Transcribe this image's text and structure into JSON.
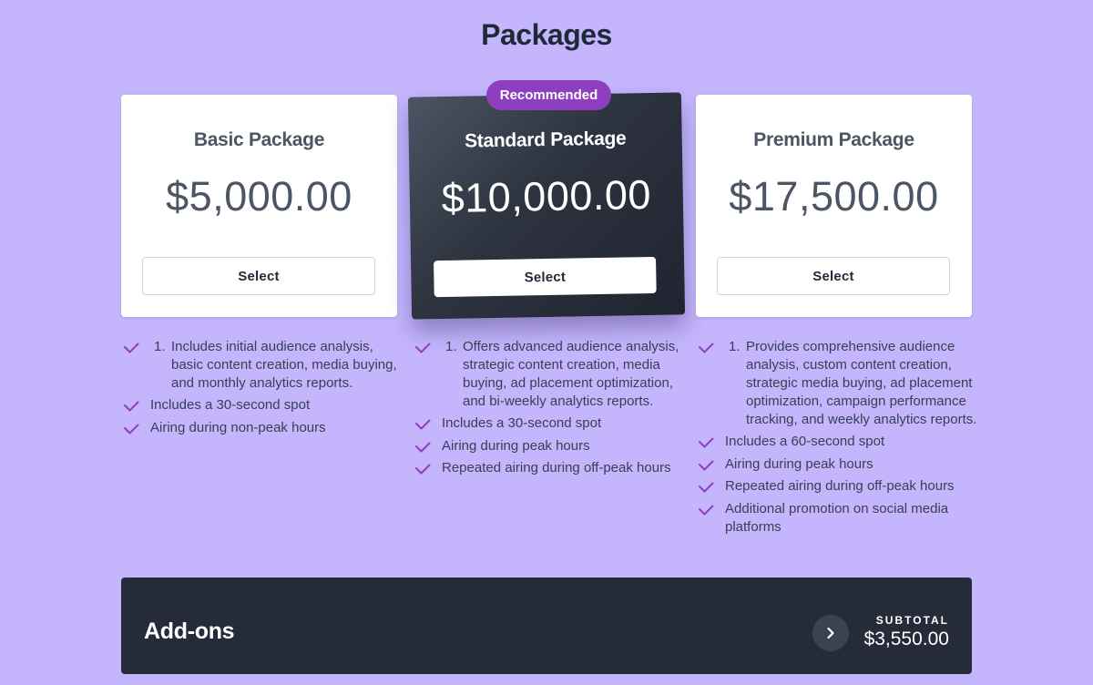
{
  "page": {
    "title": "Packages"
  },
  "badge": "Recommended",
  "packages": [
    {
      "name": "Basic Package",
      "price": "$5,000.00",
      "select_label": "Select",
      "features": [
        {
          "number": "1.",
          "text": "Includes initial audience analysis, basic content creation, media buying, and monthly analytics reports."
        },
        {
          "text": "Includes a 30-second spot"
        },
        {
          "text": "Airing during non-peak hours"
        }
      ]
    },
    {
      "name": "Standard Package",
      "price": "$10,000.00",
      "select_label": "Select",
      "features": [
        {
          "number": "1.",
          "text": "Offers advanced audience analysis, strategic content creation, media buying, ad placement optimization, and bi-weekly analytics reports."
        },
        {
          "text": "Includes a 30-second spot"
        },
        {
          "text": "Airing during peak hours"
        },
        {
          "text": "Repeated airing during off-peak hours"
        }
      ]
    },
    {
      "name": "Premium Package",
      "price": "$17,500.00",
      "select_label": "Select",
      "features": [
        {
          "number": "1.",
          "text": "Provides comprehensive audience analysis, custom content creation, strategic media buying, ad placement optimization, campaign performance tracking, and weekly analytics reports."
        },
        {
          "text": "Includes a 60-second spot"
        },
        {
          "text": "Airing during peak hours"
        },
        {
          "text": "Repeated airing during off-peak hours"
        },
        {
          "text": "Additional promotion on social media platforms"
        }
      ]
    }
  ],
  "addons": {
    "title": "Add-ons",
    "subtotal_label": "SUBTOTAL",
    "subtotal_value": "$3,550.00"
  },
  "colors": {
    "background": "#c4b5fd",
    "check": "#8e3fc0",
    "badge": "#8e3fc0",
    "dark": "#252b38"
  },
  "icons": {
    "check": "check-icon",
    "expand": "chevron-right-icon"
  }
}
